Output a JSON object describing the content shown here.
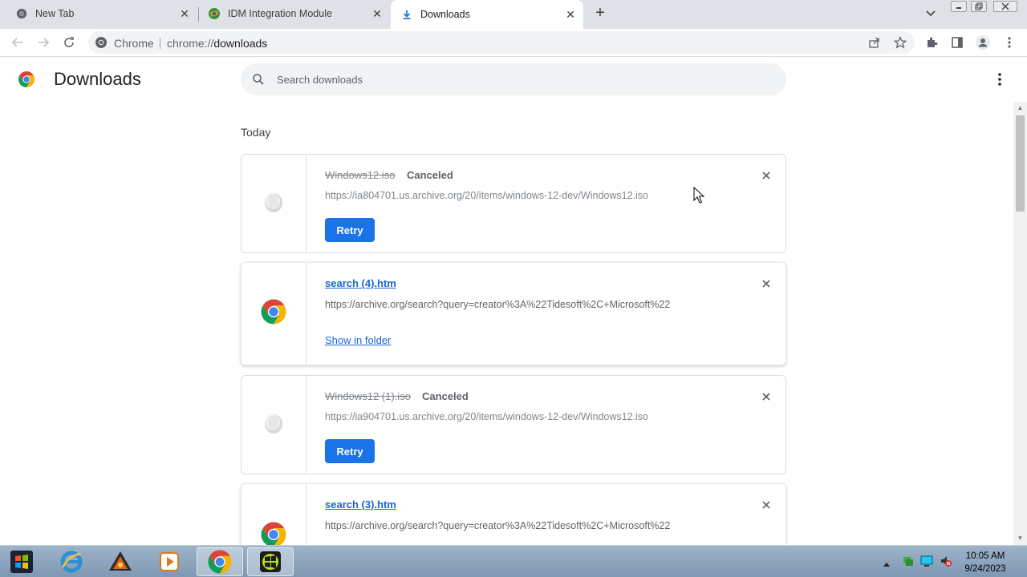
{
  "tabs": [
    {
      "title": "New Tab",
      "icon": "chrome-icon",
      "active": false
    },
    {
      "title": "IDM Integration Module",
      "icon": "idm-icon",
      "active": false
    },
    {
      "title": "Downloads",
      "icon": "download-icon",
      "active": true
    }
  ],
  "omnibox": {
    "scheme_label": "Chrome",
    "url_prefix": "chrome://",
    "url_path": "downloads"
  },
  "page": {
    "title": "Downloads",
    "search_placeholder": "Search downloads",
    "date_header": "Today"
  },
  "downloads": [
    {
      "filename": "Windows12.iso",
      "status": "Canceled",
      "url": "https://ia804701.us.archive.org/20/items/windows-12-dev/Windows12.iso",
      "action": "Retry",
      "icon": "generic-file-icon"
    },
    {
      "filename": "search (4).htm",
      "status": "",
      "url": "https://archive.org/search?query=creator%3A%22Tidesoft%2C+Microsoft%22",
      "action": "Show in folder",
      "icon": "chrome-icon"
    },
    {
      "filename": "Windows12 (1).iso",
      "status": "Canceled",
      "url": "https://ia904701.us.archive.org/20/items/windows-12-dev/Windows12.iso",
      "action": "Retry",
      "icon": "generic-file-icon"
    },
    {
      "filename": "search (3).htm",
      "status": "",
      "url": "https://archive.org/search?query=creator%3A%22Tidesoft%2C+Microsoft%22",
      "action": "",
      "icon": "chrome-icon"
    }
  ],
  "taskbar": {
    "time": "10:05 AM",
    "date": "9/24/2023"
  },
  "colors": {
    "accent": "#1a73e8",
    "link": "#1967d2",
    "tabstrip": "#dee1e6",
    "omnibox": "#f1f3f4"
  }
}
